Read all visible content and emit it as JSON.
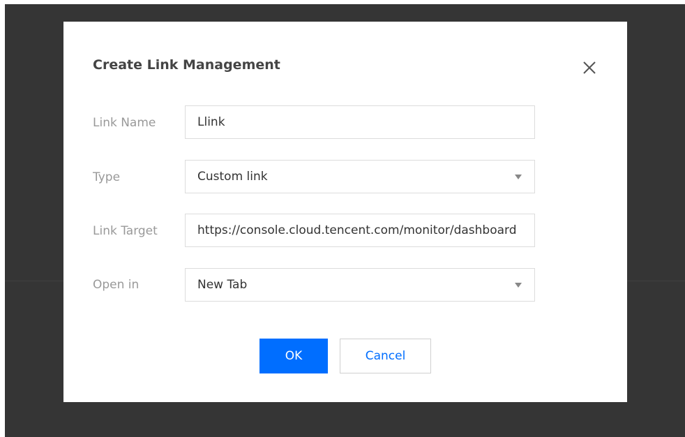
{
  "dialog": {
    "title": "Create Link Management"
  },
  "form": {
    "link_name": {
      "label": "Link Name",
      "value": "Llink"
    },
    "type": {
      "label": "Type",
      "value": "Custom link"
    },
    "link_target": {
      "label": "Link Target",
      "value": "https://console.cloud.tencent.com/monitor/dashboard"
    },
    "open_in": {
      "label": "Open in",
      "value": "New Tab"
    }
  },
  "buttons": {
    "ok_label": "OK",
    "cancel_label": "Cancel"
  },
  "colors": {
    "primary": "#006eff",
    "backdrop": "#353535"
  },
  "icons": {
    "close": "close-icon",
    "dropdown": "caret-down-icon"
  }
}
